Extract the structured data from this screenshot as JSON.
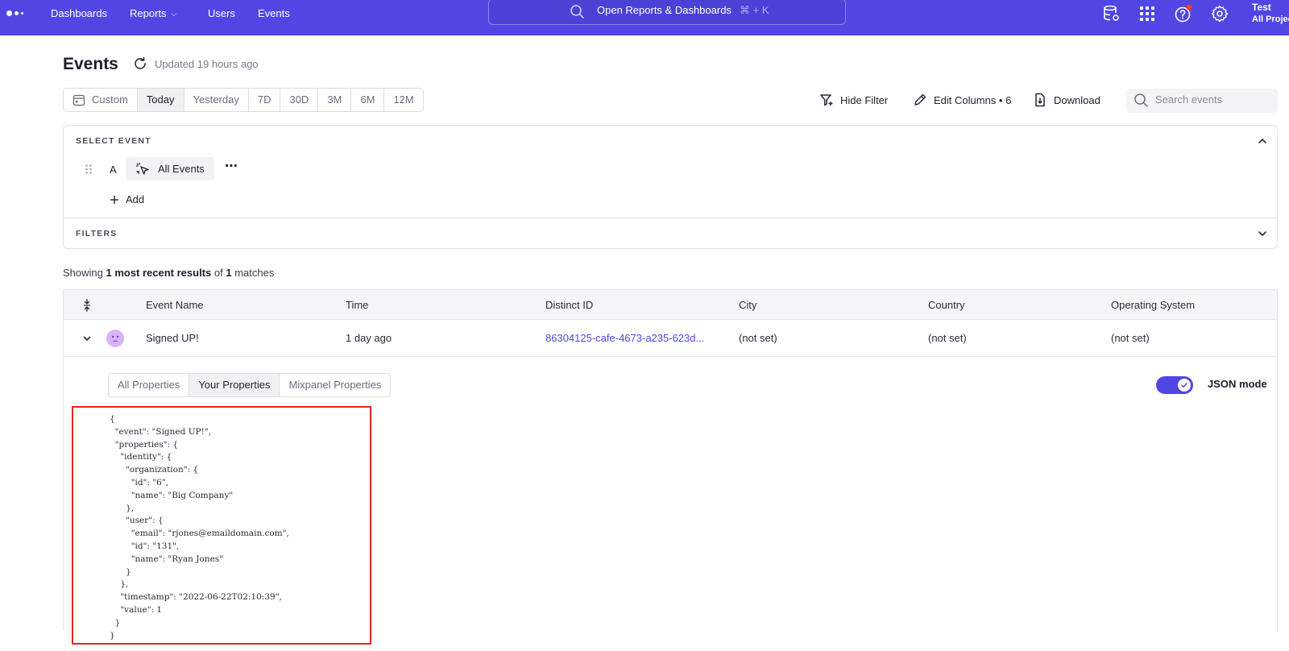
{
  "topnav": {
    "links": [
      "Dashboards",
      "Reports",
      "Users",
      "Events"
    ],
    "omnibox_text": "Open Reports & Dashboards",
    "omnibox_shortcut": "⌘ + K",
    "user_name": "Test",
    "project": "All Projec"
  },
  "header": {
    "title": "Events",
    "updated": "Updated 19 hours ago"
  },
  "date_range": {
    "options": [
      "Custom",
      "Today",
      "Yesterday",
      "7D",
      "30D",
      "3M",
      "6M",
      "12M"
    ],
    "active": "Today"
  },
  "toolbar": {
    "hide_filter": "Hide Filter",
    "edit_columns": "Edit Columns • 6",
    "download": "Download",
    "search_placeholder": "Search events"
  },
  "select_event": {
    "label": "SELECT EVENT",
    "letter": "A",
    "event_chip": "All Events",
    "add_label": "Add",
    "filters_label": "FILTERS"
  },
  "results": {
    "prefix": "Showing ",
    "bold1": "1 most recent results",
    "middle": " of ",
    "bold2": "1",
    "suffix": " matches"
  },
  "table": {
    "columns": [
      "Event Name",
      "Time",
      "Distinct ID",
      "City",
      "Country",
      "Operating System"
    ],
    "row": {
      "event_name": "Signed UP!",
      "time": "1 day ago",
      "distinct_id": "86304125-cafe-4673-a235-623d...",
      "city": "(not set)",
      "country": "(not set)",
      "os": "(not set)"
    }
  },
  "properties": {
    "tabs": [
      "All Properties",
      "Your Properties",
      "Mixpanel Properties"
    ],
    "active_tab": "Your Properties",
    "json_mode_label": "JSON mode",
    "json_mode_on": true,
    "json_text": "{\n  \"event\": \"Signed UP!\",\n  \"properties\": {\n    \"identity\": {\n      \"organization\": {\n        \"id\": \"6\",\n        \"name\": \"Big Company\"\n      },\n      \"user\": {\n        \"email\": \"rjones@emaildomain.com\",\n        \"id\": \"131\",\n        \"name\": \"Ryan Jones\"\n      }\n    },\n    \"timestamp\": \"2022-06-22T02:10:39\",\n    \"value\": 1\n  }\n}"
  },
  "colors": {
    "brand": "#5146e4",
    "highlight_border": "#e32626"
  }
}
